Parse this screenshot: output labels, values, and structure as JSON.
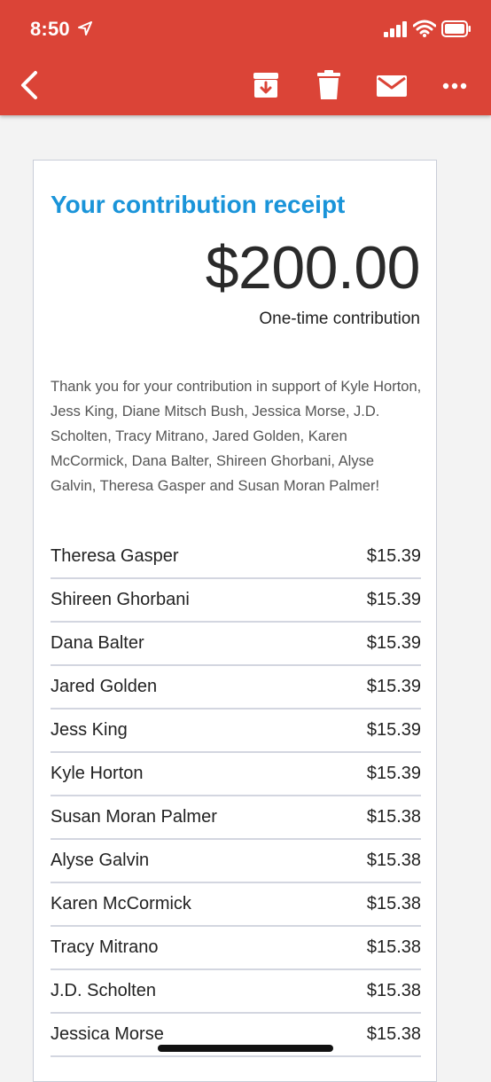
{
  "status_bar": {
    "time": "8:50",
    "location_icon": "location-arrow-icon",
    "signal_icon": "cellular-signal-icon",
    "wifi_icon": "wifi-icon",
    "battery_icon": "battery-icon"
  },
  "toolbar": {
    "back_icon": "chevron-left-icon",
    "archive_icon": "archive-icon",
    "delete_icon": "trash-icon",
    "mark_unread_icon": "envelope-icon",
    "more_icon": "more-horizontal-icon",
    "color": "#db4437"
  },
  "receipt": {
    "title": "Your contribution receipt",
    "title_color": "#1a94d9",
    "amount": "$200.00",
    "type": "One-time contribution",
    "thanks": "Thank you for your contribution in support of Kyle Horton, Jess King, Diane Mitsch Bush, Jessica Morse, J.D. Scholten, Tracy Mitrano, Jared Golden, Karen McCormick, Dana Balter, Shireen Ghorbani, Alyse Galvin, Theresa Gasper and Susan Moran Palmer!",
    "items": [
      {
        "name": "Theresa Gasper",
        "amount": "$15.39"
      },
      {
        "name": "Shireen Ghorbani",
        "amount": "$15.39"
      },
      {
        "name": "Dana Balter",
        "amount": "$15.39"
      },
      {
        "name": "Jared Golden",
        "amount": "$15.39"
      },
      {
        "name": "Jess King",
        "amount": "$15.39"
      },
      {
        "name": "Kyle Horton",
        "amount": "$15.39"
      },
      {
        "name": "Susan Moran Palmer",
        "amount": "$15.38"
      },
      {
        "name": "Alyse Galvin",
        "amount": "$15.38"
      },
      {
        "name": "Karen McCormick",
        "amount": "$15.38"
      },
      {
        "name": "Tracy Mitrano",
        "amount": "$15.38"
      },
      {
        "name": "J.D. Scholten",
        "amount": "$15.38"
      },
      {
        "name": "Jessica Morse",
        "amount": "$15.38"
      }
    ]
  }
}
